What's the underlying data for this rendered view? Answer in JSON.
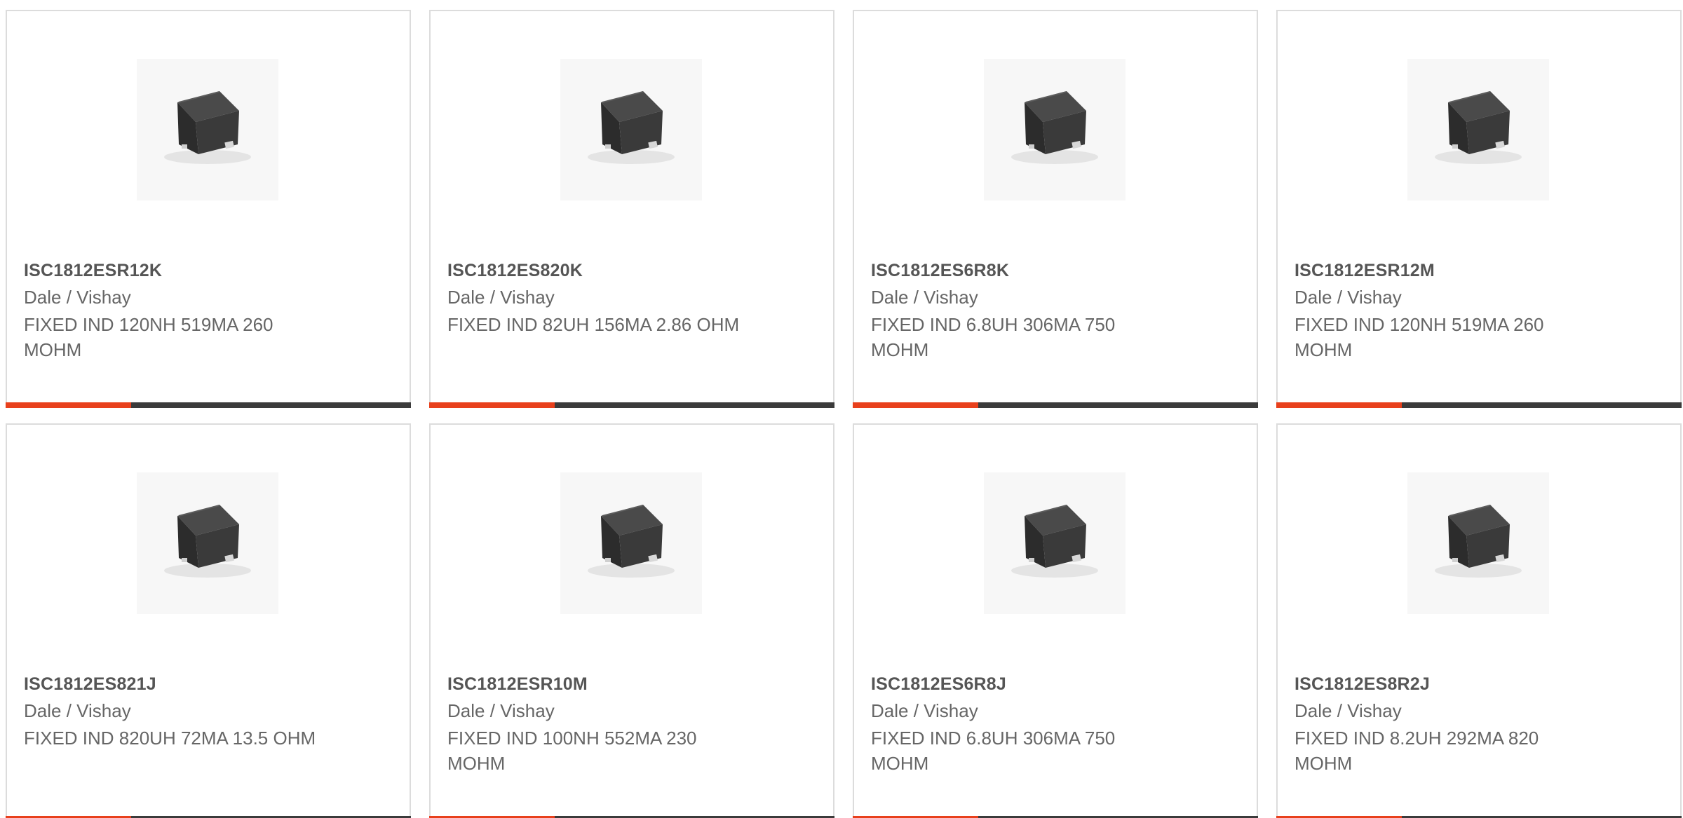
{
  "colors": {
    "accent": "#e8401c",
    "bar": "#3b3b3b",
    "border": "#dcdcdc",
    "title_text": "#555555",
    "body_text": "#666666"
  },
  "products": [
    {
      "part_number": "ISC1812ESR12K",
      "manufacturer": "Dale / Vishay",
      "description": "FIXED IND 120NH 519MA 260 MOHM",
      "image_icon": "inductor-component-image",
      "accent_fraction": 0.31
    },
    {
      "part_number": "ISC1812ES820K",
      "manufacturer": "Dale / Vishay",
      "description": "FIXED IND 82UH 156MA 2.86 OHM",
      "image_icon": "inductor-component-image",
      "accent_fraction": 0.31
    },
    {
      "part_number": "ISC1812ES6R8K",
      "manufacturer": "Dale / Vishay",
      "description": "FIXED IND 6.8UH 306MA 750 MOHM",
      "image_icon": "inductor-component-image",
      "accent_fraction": 0.31
    },
    {
      "part_number": "ISC1812ESR12M",
      "manufacturer": "Dale / Vishay",
      "description": "FIXED IND 120NH 519MA 260 MOHM",
      "image_icon": "inductor-component-image",
      "accent_fraction": 0.31
    },
    {
      "part_number": "ISC1812ES821J",
      "manufacturer": "Dale / Vishay",
      "description": "FIXED IND 820UH 72MA 13.5 OHM",
      "image_icon": "inductor-component-image",
      "accent_fraction": 0.31
    },
    {
      "part_number": "ISC1812ESR10M",
      "manufacturer": "Dale / Vishay",
      "description": "FIXED IND 100NH 552MA 230 MOHM",
      "image_icon": "inductor-component-image",
      "accent_fraction": 0.31
    },
    {
      "part_number": "ISC1812ES6R8J",
      "manufacturer": "Dale / Vishay",
      "description": "FIXED IND 6.8UH 306MA 750 MOHM",
      "image_icon": "inductor-component-image",
      "accent_fraction": 0.31
    },
    {
      "part_number": "ISC1812ES8R2J",
      "manufacturer": "Dale / Vishay",
      "description": "FIXED IND 8.2UH 292MA 820 MOHM",
      "image_icon": "inductor-component-image",
      "accent_fraction": 0.31
    }
  ]
}
